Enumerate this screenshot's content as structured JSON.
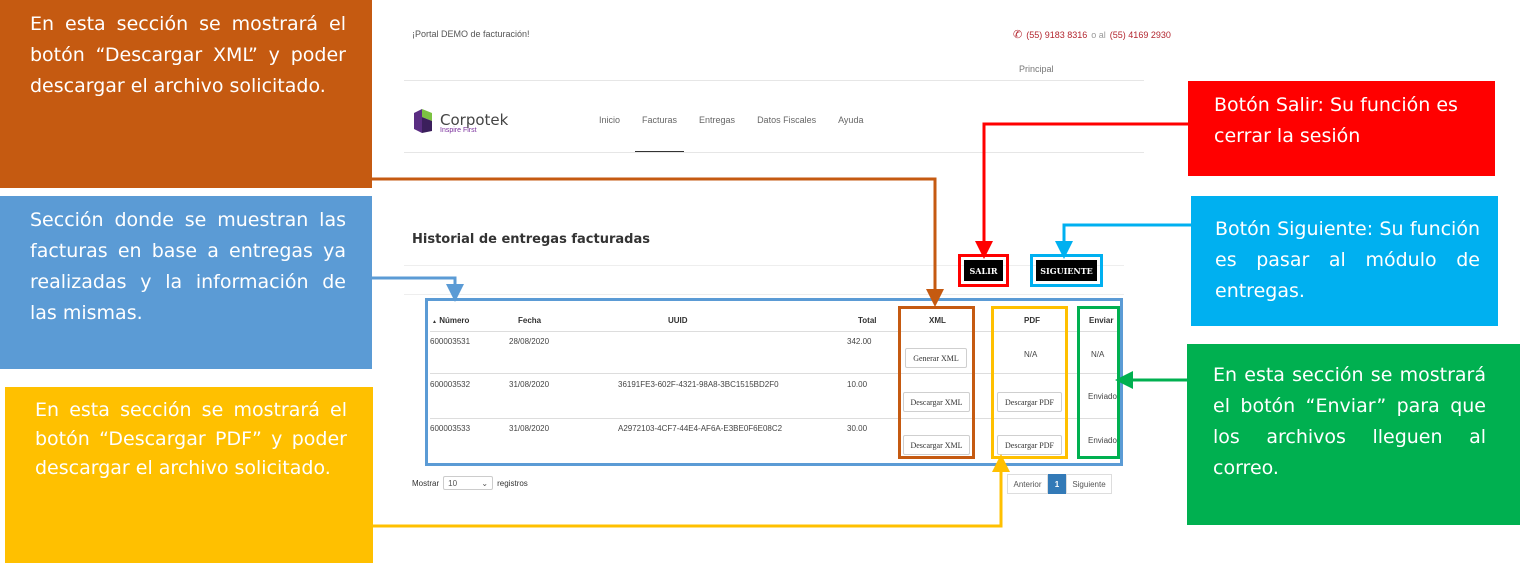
{
  "portal": {
    "top_text": "¡Portal DEMO de facturación!",
    "phone1": "(55) 9183 8316",
    "phone_sep": "o al",
    "phone2": "(55) 4169 2930",
    "principal": "Principal",
    "logo_name": "Corpotek",
    "logo_tagline": "Inspire First",
    "nav": [
      {
        "label": "Inicio"
      },
      {
        "label": "Facturas"
      },
      {
        "label": "Entregas"
      },
      {
        "label": "Datos Fiscales"
      },
      {
        "label": "Ayuda"
      }
    ],
    "active_nav": "Facturas",
    "page_title": "Historial de entregas facturadas",
    "salir_label": "SALIR",
    "siguiente_label": "SIGUIENTE"
  },
  "table": {
    "headers": [
      "Número",
      "Fecha",
      "UUID",
      "Total",
      "XML",
      "PDF",
      "Enviar"
    ],
    "sort_indicator": "▲",
    "rows": [
      {
        "numero": "600003531",
        "fecha": "28/08/2020",
        "uuid": "",
        "total": "342.00",
        "xml": "Generar XML",
        "pdf": "N/A",
        "enviar": "N/A"
      },
      {
        "numero": "600003532",
        "fecha": "31/08/2020",
        "uuid": "36191FE3-602F-4321-98A8-3BC1515BD2F0",
        "total": "10.00",
        "xml": "Descargar XML",
        "pdf": "Descargar PDF",
        "enviar": "Enviado"
      },
      {
        "numero": "600003533",
        "fecha": "31/08/2020",
        "uuid": "A2972103-4CF7-44E4-AF6A-E3BE0F6E08C2",
        "total": "30.00",
        "xml": "Descargar XML",
        "pdf": "Descargar PDF",
        "enviar": "Enviado"
      }
    ],
    "mostrar_label": "Mostrar",
    "page_size": "10",
    "registros_label": "registros",
    "pager": {
      "prev": "Anterior",
      "current": "1",
      "next": "Siguiente"
    }
  },
  "callouts": {
    "xml": "En esta sección se mostrará el botón “Descargar XML” y poder descargar el archivo solicitado.",
    "seccion": "Sección donde se muestran las facturas en base a entregas ya realizadas y la información de las mismas.",
    "pdf": "En esta sección se mostrará el botón “Descargar PDF” y poder descargar el archivo solicitado.",
    "salir": "Botón Salir: Su función es cerrar la sesión",
    "siguiente": "Botón Siguiente: Su función es pasar al módulo de entregas.",
    "enviar": "En esta sección se mostrará el botón “Enviar” para que los archivos lleguen al correo."
  },
  "colors": {
    "xml_callout": "#c55a11",
    "section_callout": "#5b9bd5",
    "pdf_callout": "#ffc000",
    "salir_callout": "#ff0000",
    "siguiente_callout": "#00b0f0",
    "enviar_callout": "#00b050",
    "phone_text": "#b3262f",
    "pager_active": "#337ab7"
  },
  "icons": {
    "phone": "phone-icon",
    "logo": "corpotek-logo-icon",
    "select_chevron": "chevron-down-icon",
    "sort": "sort-arrow-icon"
  }
}
